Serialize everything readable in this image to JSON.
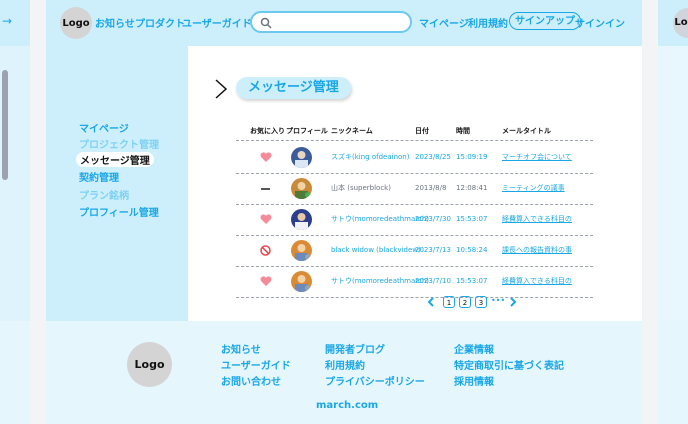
{
  "header": {
    "logo": "Logo",
    "nav_left": [
      "お知らせ",
      "プロダクト",
      "ユーザーガイド"
    ],
    "search_placeholder": "",
    "nav_right": [
      "マイページ",
      "利用規約"
    ],
    "signup": "サインアップ",
    "signin": "サインイン"
  },
  "sidebar": {
    "items": [
      {
        "label": "マイページ",
        "color": "#1aa7e6"
      },
      {
        "label": "プロジェクト管理",
        "color": "#7fd1f4"
      },
      {
        "label": "メッセージ管理",
        "color": "#1aa7e6"
      },
      {
        "label": "契約管理",
        "color": "#1aa7e6"
      },
      {
        "label": "プラン銘柄",
        "color": "#7fd1f4"
      },
      {
        "label": "プロフィール管理",
        "color": "#1aa7e6"
      }
    ]
  },
  "page": {
    "title": "メッセージ管理"
  },
  "table": {
    "headers": [
      "お気に入り",
      "プロフィール",
      "ニックネーム",
      "日付",
      "時間",
      "メールタイトル"
    ],
    "rows": [
      {
        "fav": "heart",
        "name": "スズキ(king ofdeainon)",
        "date": "2023/8/25",
        "time": "15:09:19",
        "title": "マーチオフ会について",
        "muted": false
      },
      {
        "fav": "dash",
        "name": "山本 (superblock)",
        "date": "2013/8/8",
        "time": "12:08:41",
        "title": "ミーティングの議事",
        "muted": true
      },
      {
        "fav": "heart",
        "name": "サトウ(momoredeathmarch)",
        "date": "2023/7/30",
        "time": "15:53:07",
        "title": "経費算入できる科目の",
        "muted": false
      },
      {
        "fav": "blocked",
        "name": "black widow (blackvidew)",
        "date": "2023/7/13",
        "time": "10:58:24",
        "title": "課長への報告資料の事",
        "muted": false
      },
      {
        "fav": "heart",
        "name": "サトウ(momoredeathmarch)",
        "date": "2023/7/10",
        "time": "15:53:07",
        "title": "経費算入できる科目の",
        "muted": false
      }
    ]
  },
  "pagination": {
    "pages": [
      "1",
      "2",
      "3"
    ],
    "ellipsis": "•••"
  },
  "footer": {
    "logo": "Logo",
    "col1": [
      "お知らせ",
      "ユーザーガイド",
      "お問い合わせ"
    ],
    "col2": [
      "開発者ブログ",
      "利用規約",
      "プライバシーポリシー"
    ],
    "col3": [
      "企業情報",
      "特定商取引に基づく表記",
      "採用情報"
    ],
    "domain": "march.com"
  },
  "colors": {
    "accent": "#1aa7e6",
    "header_bg": "#cdeffc",
    "heart": "#f48a9a",
    "blocked": "#e5484d"
  }
}
